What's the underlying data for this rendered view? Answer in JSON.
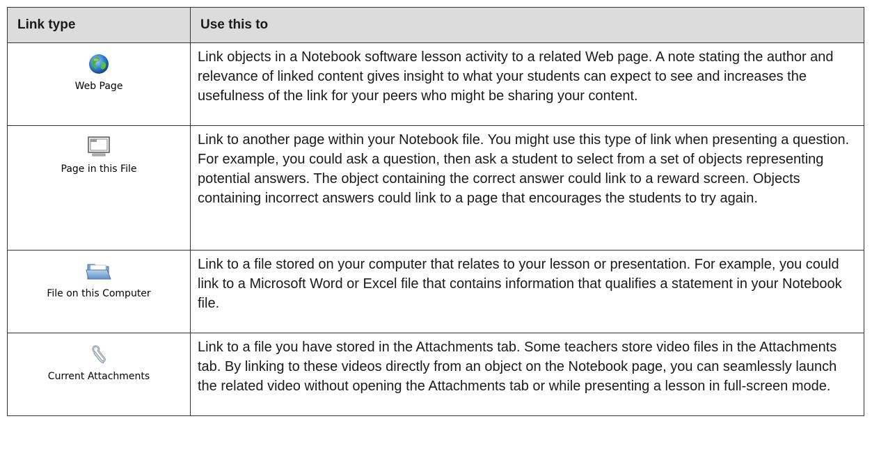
{
  "table": {
    "headers": [
      "Link type",
      "Use this to"
    ],
    "rows": [
      {
        "icon": "globe-icon",
        "label": "Web Page",
        "description": "Link objects in a Notebook software lesson activity to a related Web page. A note stating the author and relevance of linked content gives insight to what your students can expect to see and increases the usefulness of the link for your peers who might be sharing your content."
      },
      {
        "icon": "window-page-icon",
        "label": "Page in this File",
        "description": "Link to another page within your Notebook file. You might use this type of link when presenting a question. For example, you could ask a question, then ask a student to select from a set of objects representing potential answers. The object containing the correct answer could link to a reward screen. Objects containing incorrect answers could link to a page that encourages the students to try again."
      },
      {
        "icon": "folder-icon",
        "label": "File on this Computer",
        "description": "Link to a file stored on your computer that relates to your lesson or presentation. For example, you could link to a Microsoft Word or Excel file that contains information that qualifies a statement in your Notebook file."
      },
      {
        "icon": "paperclip-icon",
        "label": "Current Attachments",
        "description": "Link to a file you have stored in the Attachments tab. Some teachers store video files in the Attachments tab. By linking to these videos directly from an object on the Notebook page, you can seamlessly launch the related video without opening the Attachments tab or while presenting a lesson in full-screen mode."
      }
    ]
  }
}
